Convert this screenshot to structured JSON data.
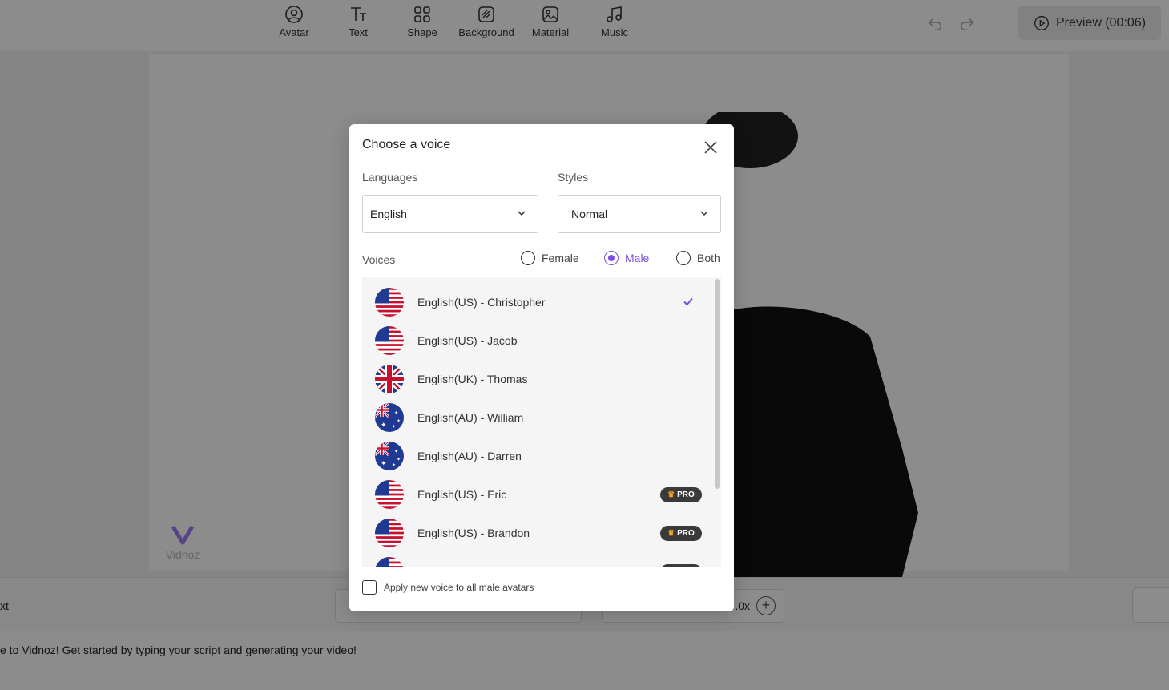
{
  "toolbar": {
    "tools": [
      {
        "label": "Avatar",
        "icon": "avatar-icon"
      },
      {
        "label": "Text",
        "icon": "text-icon"
      },
      {
        "label": "Shape",
        "icon": "shape-icon"
      },
      {
        "label": "Background",
        "icon": "background-icon"
      },
      {
        "label": "Material",
        "icon": "material-icon"
      },
      {
        "label": "Music",
        "icon": "music-icon"
      }
    ],
    "preview_label": "Preview (00:06)"
  },
  "canvas": {
    "watermark": "Vidnoz"
  },
  "bottom_bar": {
    "text_tab": "xt",
    "speed_value": ".0x",
    "script_text": "e to Vidnoz! Get started by typing your script and generating your video!"
  },
  "modal": {
    "title": "Choose a voice",
    "languages_label": "Languages",
    "language_value": "English",
    "styles_label": "Styles",
    "style_value": "Normal",
    "voices_label": "Voices",
    "gender_options": [
      {
        "label": "Female",
        "selected": false
      },
      {
        "label": "Male",
        "selected": true
      },
      {
        "label": "Both",
        "selected": false
      }
    ],
    "voices": [
      {
        "name": "English(US) - Christopher",
        "flag": "us",
        "selected": true,
        "pro": false
      },
      {
        "name": "English(US) - Jacob",
        "flag": "us",
        "selected": false,
        "pro": false
      },
      {
        "name": "English(UK) - Thomas",
        "flag": "uk",
        "selected": false,
        "pro": false
      },
      {
        "name": "English(AU) - William",
        "flag": "au",
        "selected": false,
        "pro": false
      },
      {
        "name": "English(AU) - Darren",
        "flag": "au",
        "selected": false,
        "pro": false
      },
      {
        "name": "English(US) - Eric",
        "flag": "us",
        "selected": false,
        "pro": true
      },
      {
        "name": "English(US) - Brandon",
        "flag": "us",
        "selected": false,
        "pro": true
      },
      {
        "name": "",
        "flag": "us",
        "selected": false,
        "pro": true
      }
    ],
    "pro_label": "PRO",
    "apply_label": "Apply new voice to all male avatars",
    "accent_color": "#7a4fe0"
  }
}
